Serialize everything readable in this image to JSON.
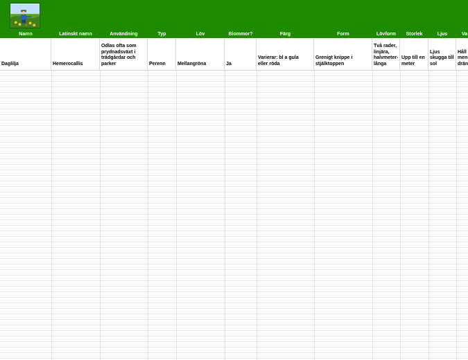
{
  "header": {
    "name": "Namn",
    "latin_name": "Latinskt namn",
    "usage": "Användning",
    "type": "Typ",
    "leaf": "Löv",
    "flowers": "Blommor?",
    "color": "Färg",
    "form": "Form",
    "leaf_form": "Lövform",
    "size": "Storlek",
    "light": "Ljus",
    "water": "Va"
  },
  "row": {
    "name": "Daglilja",
    "latin_name": "Hemerocallis",
    "usage": [
      "Odlas ofta som",
      "prydnadsväxt i",
      "trädgårdar och",
      "parker"
    ],
    "type": "Perenn",
    "leaf": "Mellangröna",
    "flowers": "Ja",
    "color": [
      "Varierar: bl a gula",
      "eller röda"
    ],
    "form": [
      "Grenigt knippe i",
      "stjälktoppen"
    ],
    "leaf_form": [
      "Två rader,",
      "linjära,",
      "halvmeter-",
      "långa"
    ],
    "size": [
      "Upp till en",
      "meter"
    ],
    "light": [
      "Ljus",
      "skugga till",
      "sol"
    ],
    "water": [
      "Håll",
      "men",
      "drän"
    ]
  },
  "colors": {
    "banner": "#1e8a00",
    "header_text": "#ffffff",
    "gridline": "#e4e4e4"
  }
}
